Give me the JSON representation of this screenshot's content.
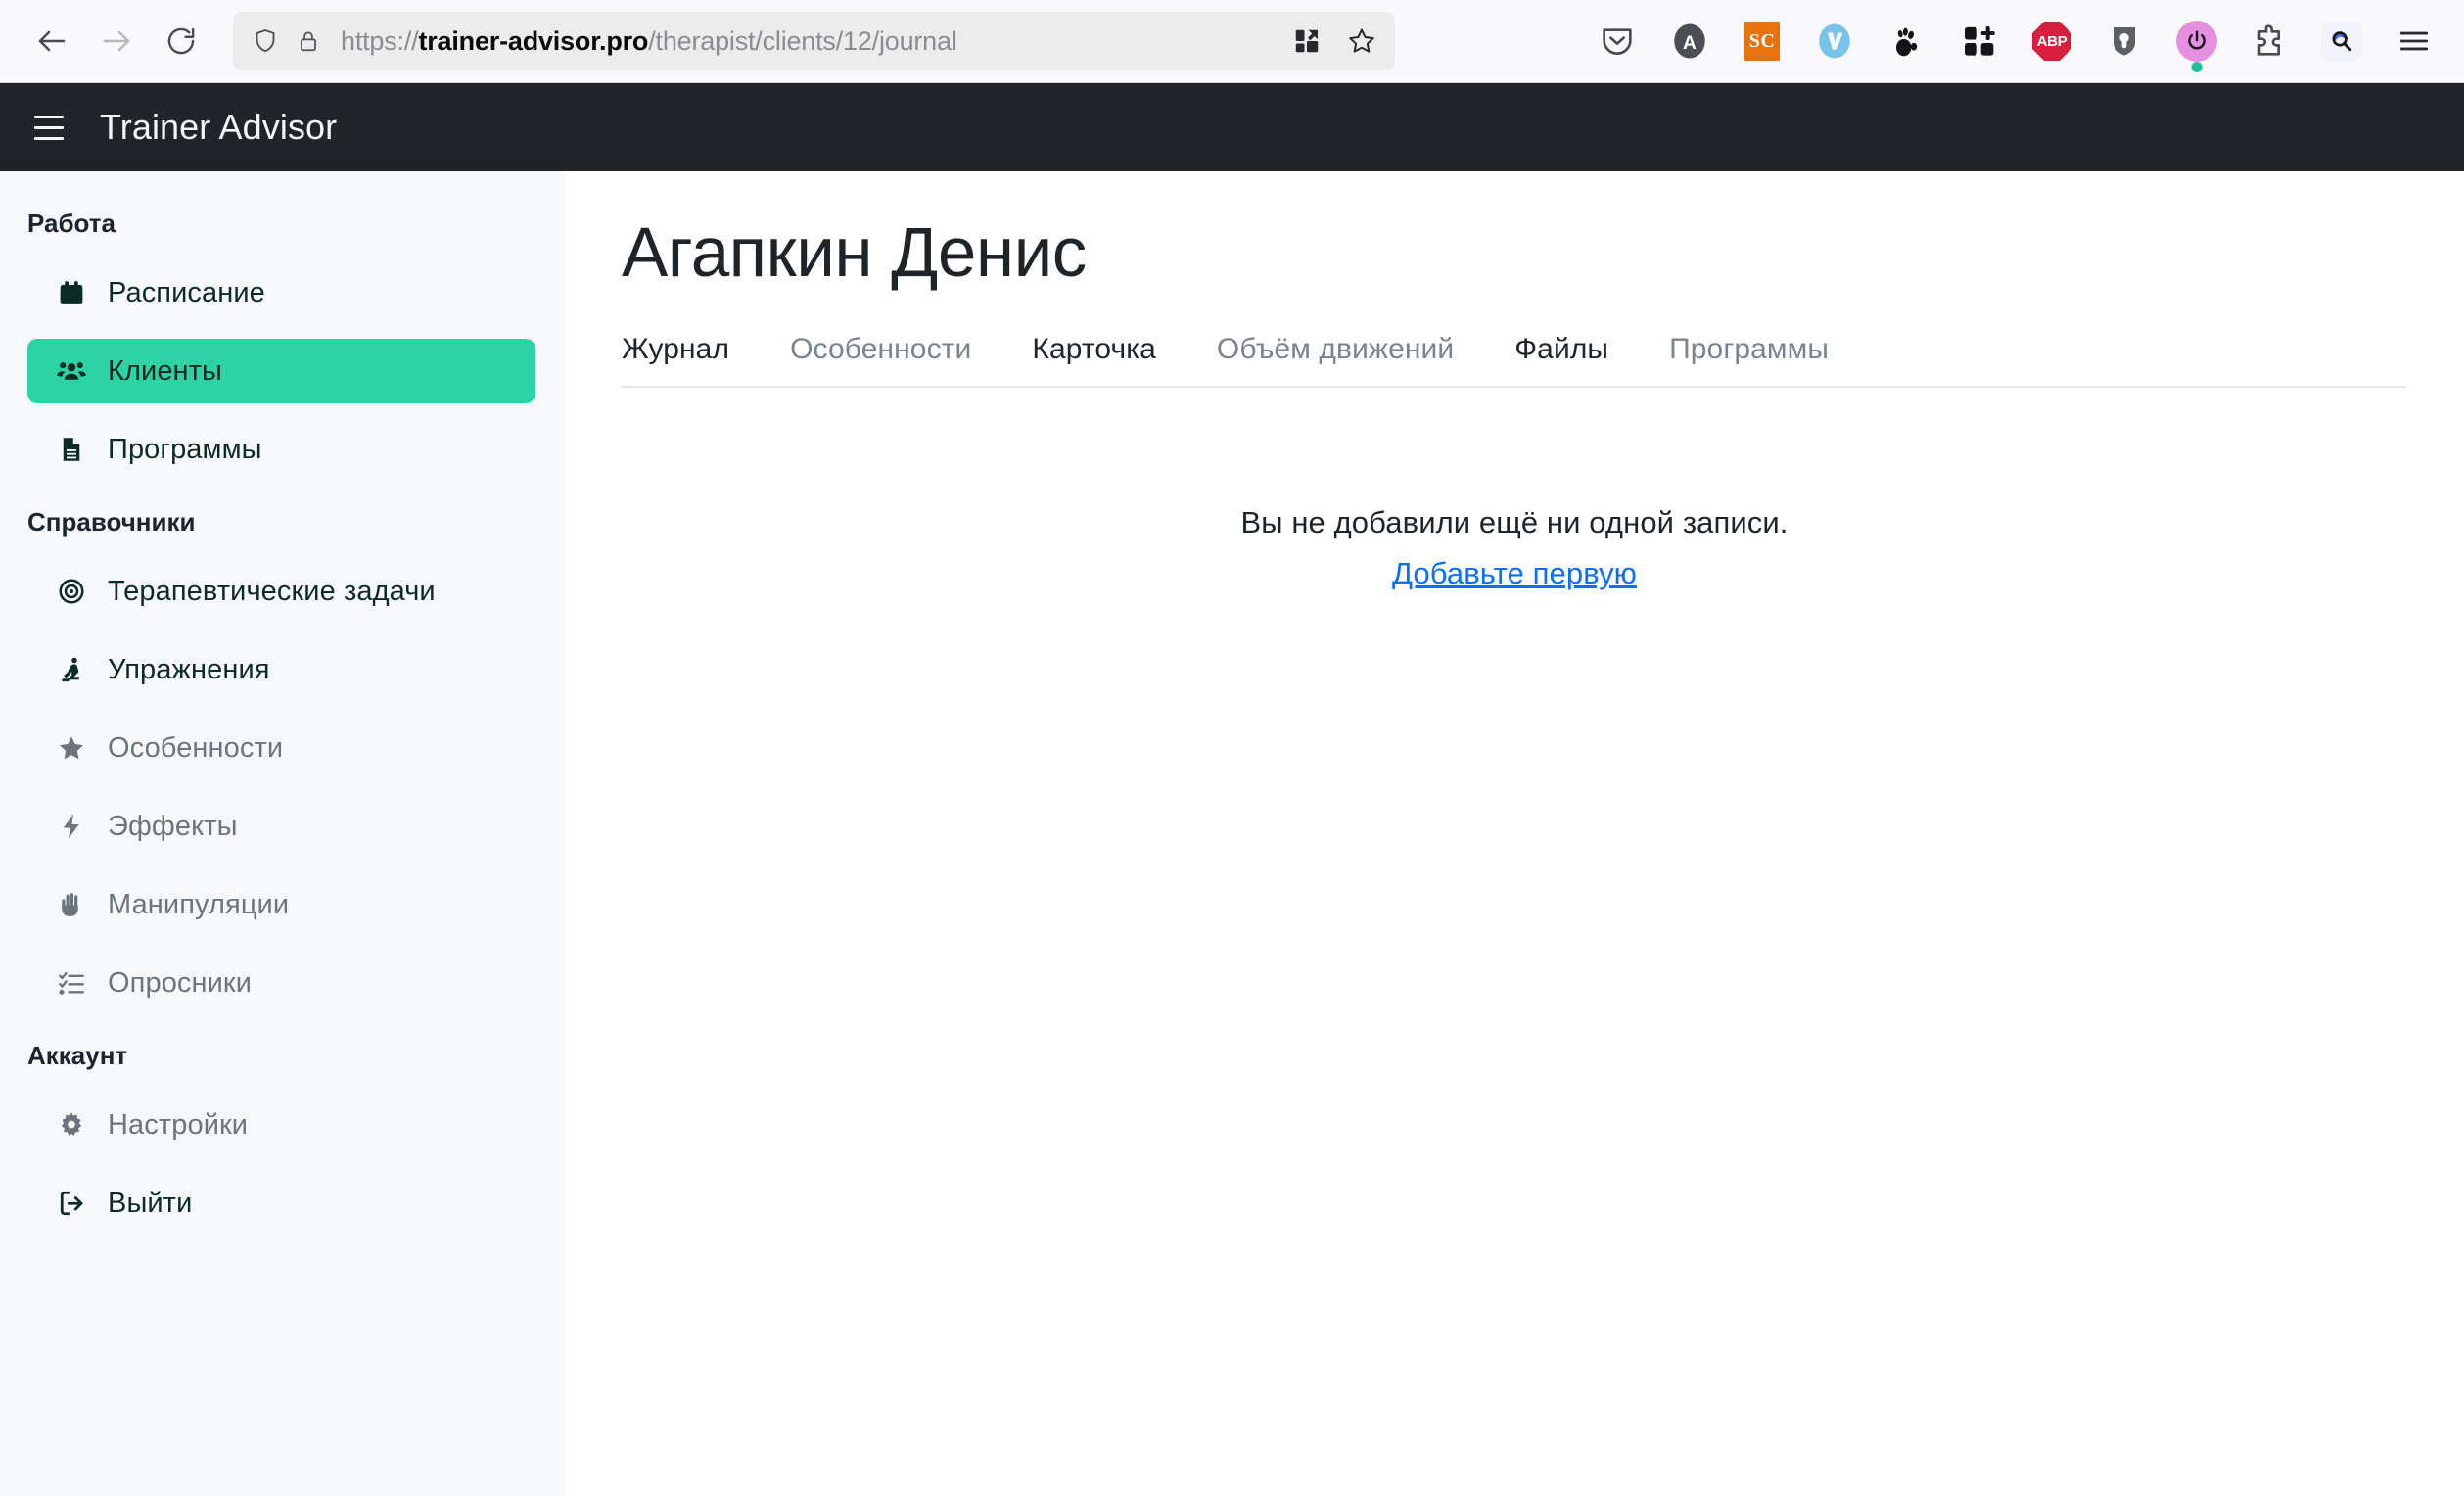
{
  "browser": {
    "nav": {
      "back_label": "Назад",
      "forward_label": "Вперёд",
      "reload_label": "Обновить"
    },
    "url": {
      "scheme": "https://",
      "domain": "trainer-advisor.pro",
      "path": "/therapist/clients/12/journal",
      "full": "https://trainer-advisor.pro/therapist/clients/12/journal",
      "shield_icon": "shield-icon",
      "lock_icon": "lock-icon",
      "reader_icon": "reader-view-icon",
      "bookmark_icon": "bookmark-star-icon"
    },
    "extensions": [
      {
        "name": "pocket-icon",
        "label": "Pocket"
      },
      {
        "name": "adblock-a-icon",
        "label": "A"
      },
      {
        "name": "screenshot-sc-icon",
        "label": "SC"
      },
      {
        "name": "vimium-v-icon",
        "label": "V"
      },
      {
        "name": "gnome-foot-icon",
        "label": "GNOME"
      },
      {
        "name": "grid-plus-icon",
        "label": "Add"
      },
      {
        "name": "adblock-plus-icon",
        "label": "ABP"
      },
      {
        "name": "bitwarden-icon",
        "label": "Bitwarden"
      },
      {
        "name": "power-toggle-icon",
        "label": "Power"
      },
      {
        "name": "extensions-puzzle-icon",
        "label": "Extensions"
      },
      {
        "name": "search-magnifier-icon",
        "label": "Search"
      }
    ],
    "menu_icon": "hamburger-menu-icon"
  },
  "app": {
    "brand": "Trainer Advisor",
    "menu_icon": "hamburger-menu-icon"
  },
  "sidebar": {
    "groups": [
      {
        "title": "Работа",
        "items": [
          {
            "label": "Расписание",
            "icon": "calendar-icon",
            "state": "dark"
          },
          {
            "label": "Клиенты",
            "icon": "people-group-icon",
            "state": "active"
          },
          {
            "label": "Программы",
            "icon": "document-lines-icon",
            "state": "dark"
          }
        ]
      },
      {
        "title": "Справочники",
        "items": [
          {
            "label": "Терапевтические задачи",
            "icon": "target-icon",
            "state": "dark"
          },
          {
            "label": "Упражнения",
            "icon": "person-exercise-icon",
            "state": "dark"
          },
          {
            "label": "Особенности",
            "icon": "star-icon",
            "state": "muted"
          },
          {
            "label": "Эффекты",
            "icon": "lightning-bolt-icon",
            "state": "muted"
          },
          {
            "label": "Манипуляции",
            "icon": "hand-icon",
            "state": "muted"
          },
          {
            "label": "Опросники",
            "icon": "checklist-icon",
            "state": "muted"
          }
        ]
      },
      {
        "title": "Аккаунт",
        "items": [
          {
            "label": "Настройки",
            "icon": "gear-icon",
            "state": "muted"
          },
          {
            "label": "Выйти",
            "icon": "logout-icon",
            "state": "dark"
          }
        ]
      }
    ]
  },
  "main": {
    "title": "Агапкин Денис",
    "tabs": [
      {
        "label": "Журнал",
        "state": "dark"
      },
      {
        "label": "Особенности",
        "state": "muted"
      },
      {
        "label": "Карточка",
        "state": "dark"
      },
      {
        "label": "Объём движений",
        "state": "muted"
      },
      {
        "label": "Файлы",
        "state": "dark"
      },
      {
        "label": "Программы",
        "state": "muted"
      }
    ],
    "empty_state": {
      "message": "Вы не добавили ещё ни одной записи.",
      "link": "Добавьте первую"
    }
  },
  "colors": {
    "accent_green": "#2dd3a4",
    "navbar_dark": "#212529",
    "sidebar_bg": "#f7f8fa",
    "link_blue": "#0d6efd",
    "muted_text": "#6c757d"
  }
}
